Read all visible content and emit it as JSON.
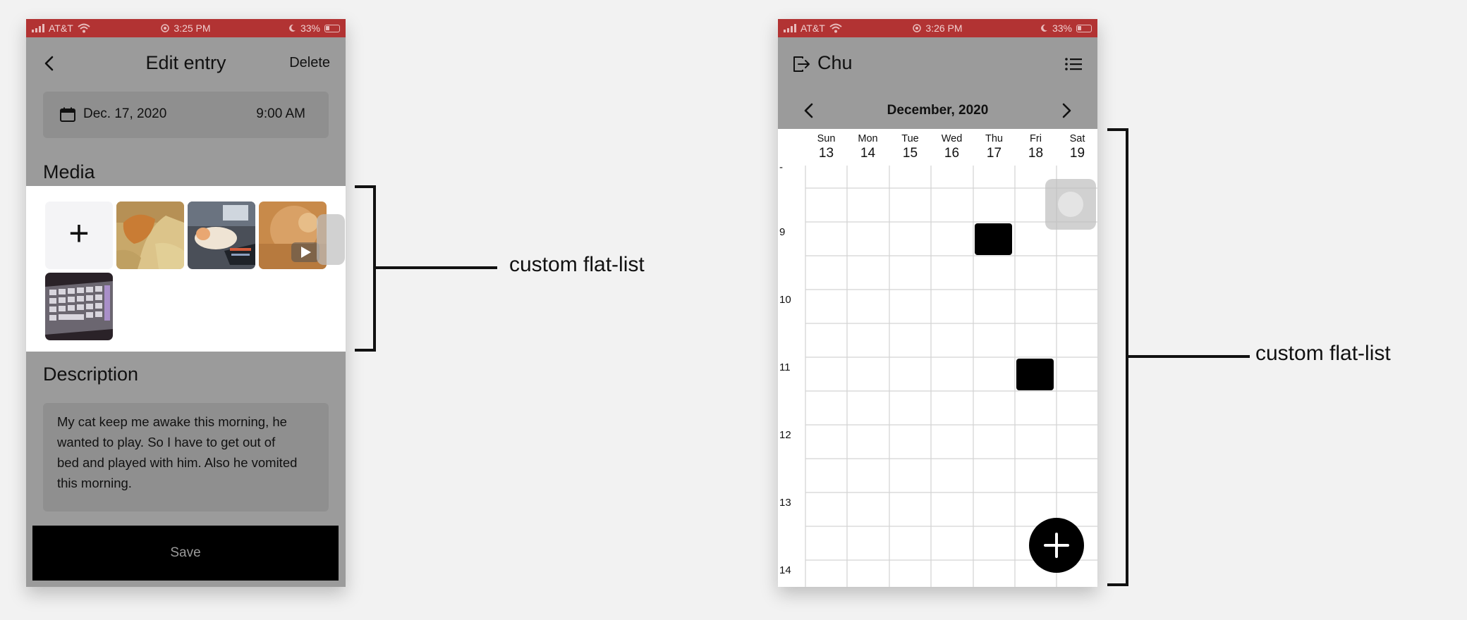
{
  "left_screen": {
    "statusbar": {
      "carrier": "AT&T",
      "time": "3:25 PM",
      "battery": "33%"
    },
    "header": {
      "title": "Edit entry",
      "delete_label": "Delete"
    },
    "datetime": {
      "date": "Dec. 17, 2020",
      "time": "9:00 AM"
    },
    "media": {
      "title": "Media",
      "add_label": "+",
      "items": [
        {
          "kind": "photo",
          "subject": "cat on blanket"
        },
        {
          "kind": "photo",
          "subject": "cat on keyboard"
        },
        {
          "kind": "video",
          "subject": "cat close-up"
        },
        {
          "kind": "photo",
          "subject": "mechanical keyboard"
        }
      ]
    },
    "description": {
      "title": "Description",
      "lines": [
        "My cat keep me awake this morning, he",
        "wanted to play. So I have to get out of",
        "bed and played with him. Also he vomited",
        "this morning."
      ]
    },
    "save_label": "Save"
  },
  "right_screen": {
    "statusbar": {
      "carrier": "AT&T",
      "time": "3:26 PM",
      "battery": "33%"
    },
    "header": {
      "user": "Chu"
    },
    "month_title": "December, 2020",
    "days": [
      {
        "name": "Sun",
        "num": "13"
      },
      {
        "name": "Mon",
        "num": "14"
      },
      {
        "name": "Tue",
        "num": "15"
      },
      {
        "name": "Wed",
        "num": "16"
      },
      {
        "name": "Thu",
        "num": "17"
      },
      {
        "name": "Fri",
        "num": "18"
      },
      {
        "name": "Sat",
        "num": "19"
      }
    ],
    "hours": [
      "-",
      "9",
      "10",
      "11",
      "12",
      "13",
      "14"
    ],
    "events": [
      {
        "day": "Thu",
        "hour": "9"
      },
      {
        "day": "Fri",
        "hour": "11"
      }
    ],
    "add_label": "+"
  },
  "annotations": {
    "left_label": "custom flat-list",
    "right_label": "custom flat-list"
  },
  "colors": {
    "statusbar": "#b23333",
    "overlay": "#9b9b9b",
    "white": "#ffffff",
    "black": "#000000",
    "page_background": "#f2f2f2"
  }
}
